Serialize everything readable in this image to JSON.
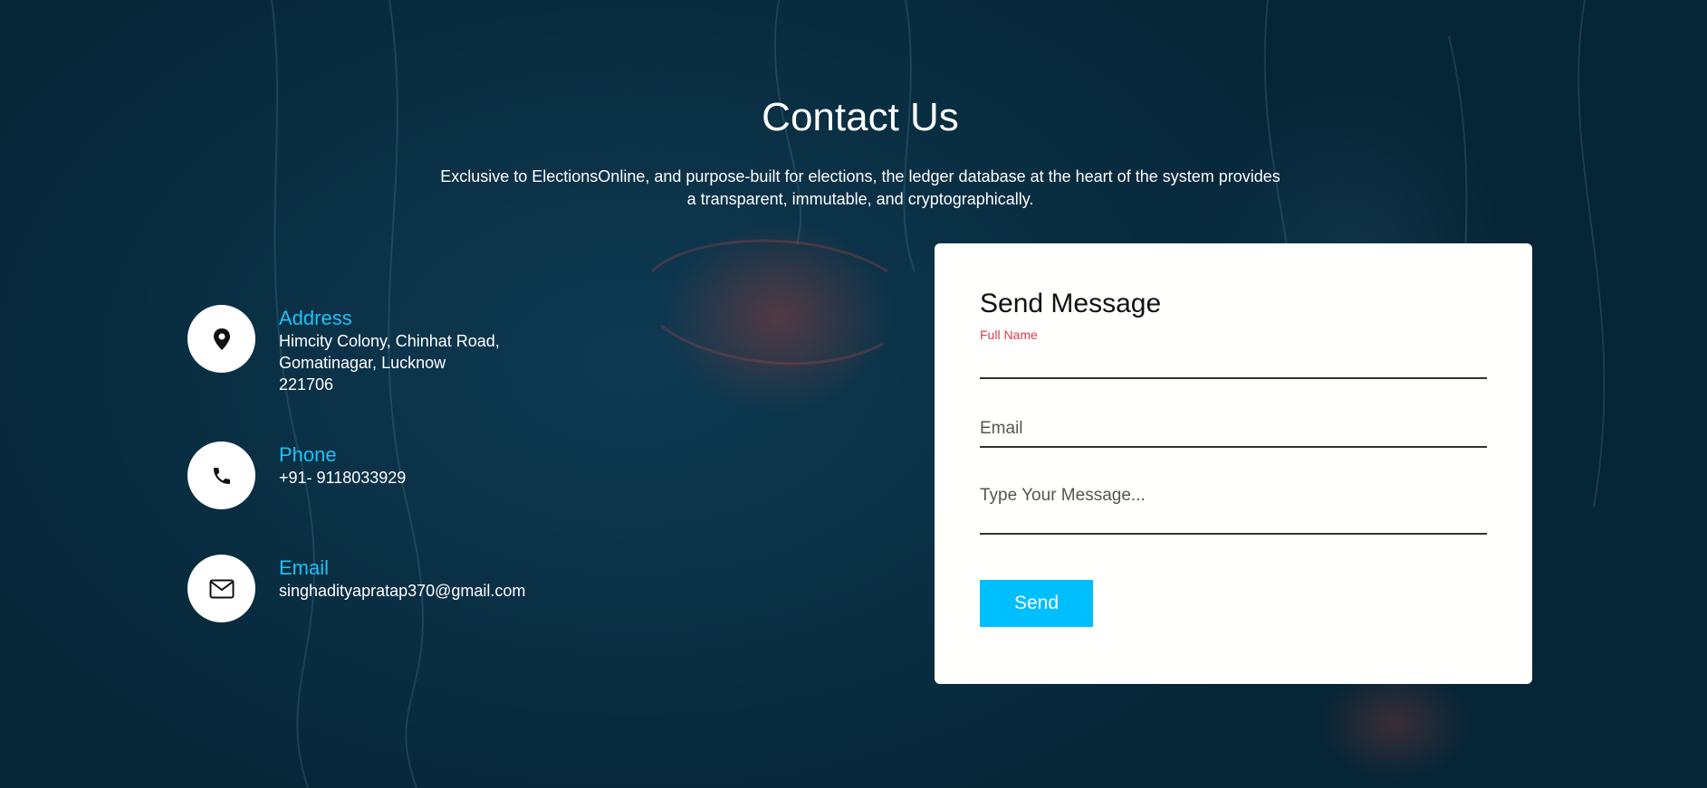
{
  "header": {
    "title": "Contact Us",
    "subtitle_line1": "Exclusive to ElectionsOnline, and purpose-built for elections, the ledger database at the heart of the system provides",
    "subtitle_line2": "a transparent, immutable, and cryptographically."
  },
  "contact_info": {
    "address": {
      "label": "Address",
      "line1": "Himcity Colony, Chinhat Road,",
      "line2": "Gomatinagar, Lucknow",
      "line3": "221706",
      "icon": "map-pin-icon"
    },
    "phone": {
      "label": "Phone",
      "value": "+91- 9118033929",
      "icon": "phone-icon"
    },
    "email": {
      "label": "Email",
      "value": "singhadityapratap370@gmail.com",
      "icon": "envelope-icon"
    }
  },
  "form": {
    "title": "Send Message",
    "full_name_label": "Full Name",
    "full_name_value": "",
    "email_placeholder": "Email",
    "email_value": "",
    "message_placeholder": "Type Your Message...",
    "message_value": "",
    "send_label": "Send"
  },
  "colors": {
    "accent": "#1fc2f5",
    "button": "#00bfff",
    "label_active": "#e23a4d",
    "background": "#0b3247"
  }
}
